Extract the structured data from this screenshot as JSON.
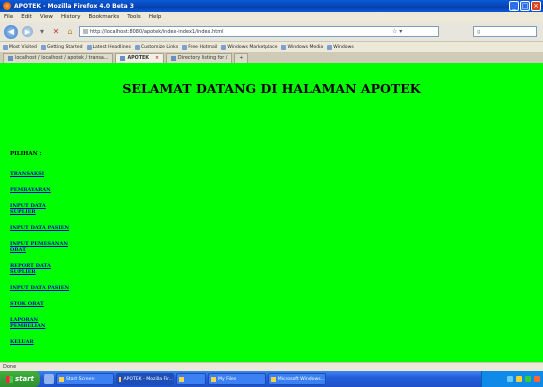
{
  "window": {
    "title": "APOTEK - Mozilla Firefox 4.0 Beta 3",
    "buttons": [
      "minimize",
      "maximize",
      "close"
    ]
  },
  "menubar": [
    "File",
    "Edit",
    "View",
    "History",
    "Bookmarks",
    "Tools",
    "Help"
  ],
  "navbar": {
    "url": "http://localhost:8080/apotek/index-index1/index.html"
  },
  "bookmarks": [
    "Most Visited",
    "Getting Started",
    "Latest Headlines",
    "Customize Links",
    "Free Hotmail",
    "Windows Marketplace",
    "Windows Media",
    "Windows"
  ],
  "tabs": [
    {
      "label": "localhost / localhost / apotek / transa...",
      "active": false
    },
    {
      "label": "APOTEK",
      "active": true
    },
    {
      "label": "Directory listing for /",
      "active": false
    }
  ],
  "page": {
    "headline": "SELAMAT DATANG DI HALAMAN APOTEK",
    "menu_title": "PILIHAN :",
    "links": [
      "TRANSAKSI",
      "PEMBAYARAN",
      "INPUT DATA SUPLIER",
      "INPUT DATA PASIEN",
      "INPUT PEMESANAN OBAT",
      "REPORT DATA SUPLIER",
      "INPUT DATA PASIEN",
      "STOK OBAT",
      "LAPORAN PEMBELIAN",
      "KELUAR"
    ],
    "background_color": "#00ff00"
  },
  "status": "Done",
  "taskbar": {
    "start_label": "start",
    "items": [
      "Start Screen",
      "APOTEK - Mozilla Fir...",
      "",
      "My Files",
      "Microsoft Windows..."
    ],
    "active_index": 1
  }
}
